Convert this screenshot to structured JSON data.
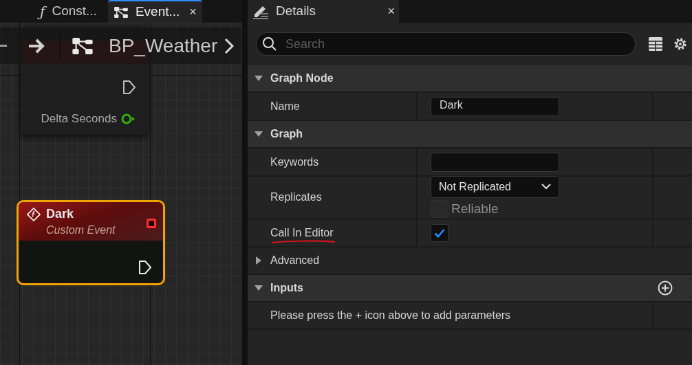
{
  "graph_tabs": [
    {
      "kind": "function",
      "symbol": "ƒ",
      "label": "Const...",
      "selected": false
    },
    {
      "kind": "graph",
      "label": "Event...",
      "selected": true,
      "close": "×"
    }
  ],
  "breadcrumb": {
    "label": "BP_Weather"
  },
  "tick_node": {
    "pin_label": "Delta Seconds"
  },
  "event_node": {
    "title": "Dark",
    "subtitle": "Custom Event",
    "selected": true
  },
  "details": {
    "tab": {
      "label": "Details",
      "close": "×"
    },
    "search": {
      "placeholder": "Search"
    },
    "sections": [
      {
        "kind": "category",
        "title": "Graph Node",
        "expanded": true,
        "rows": [
          {
            "kind": "text",
            "label": "Name",
            "value": "Dark"
          }
        ]
      },
      {
        "kind": "category",
        "title": "Graph",
        "expanded": true,
        "rows": [
          {
            "kind": "text",
            "label": "Keywords"
          },
          {
            "kind": "dropdown",
            "label": "Replicates",
            "value": "Not Replicated",
            "option": {
              "label": "Reliable",
              "checked": false,
              "disabled": true
            }
          },
          {
            "kind": "checkbox",
            "label": "Call In Editor",
            "checked": true,
            "underlined": true
          }
        ]
      },
      {
        "kind": "subcategory",
        "title": "Advanced",
        "expanded": false
      },
      {
        "kind": "category",
        "title": "Inputs",
        "expanded": true,
        "add_button": true,
        "rows": [
          {
            "kind": "note",
            "label": "Please press the + icon above to add parameters"
          }
        ]
      }
    ]
  }
}
